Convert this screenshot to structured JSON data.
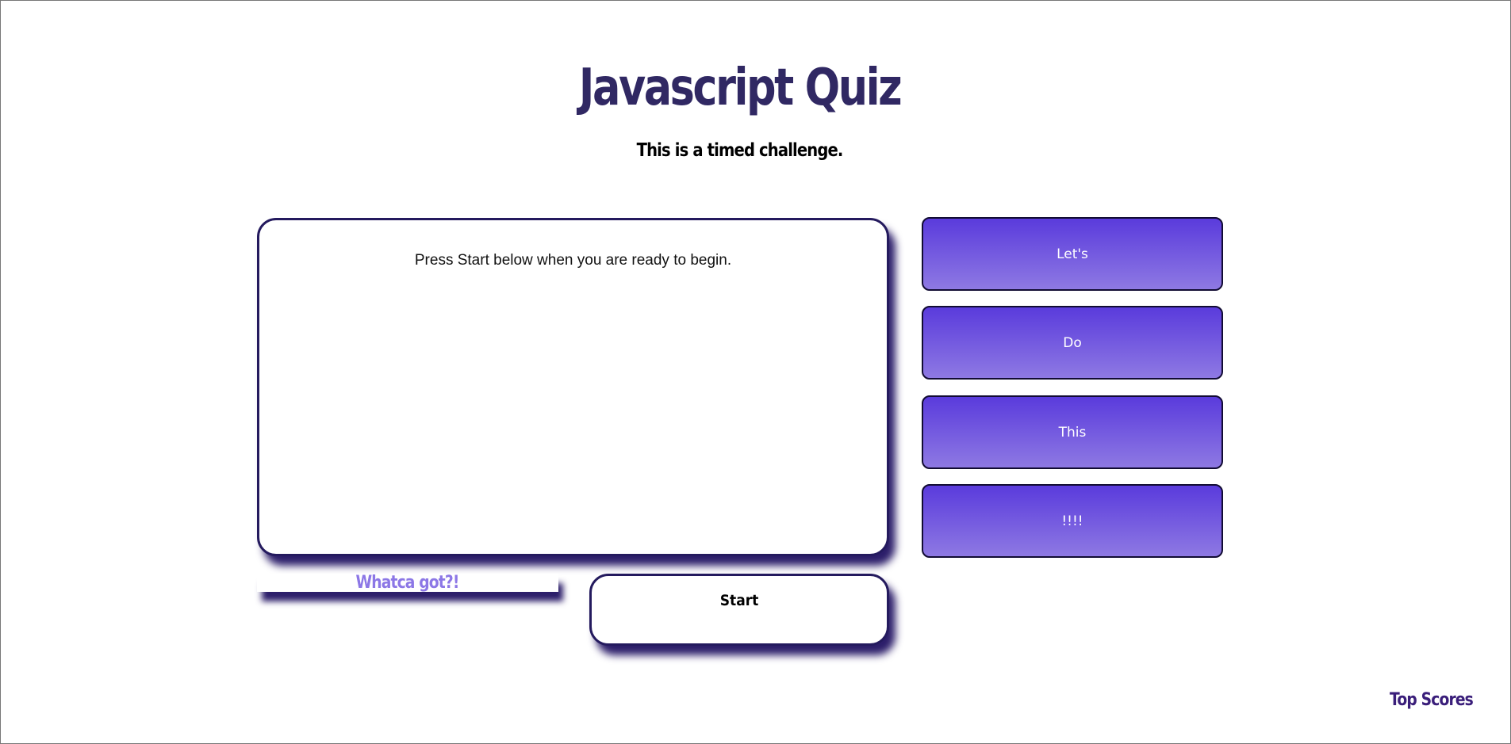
{
  "header": {
    "title": "Javascript Quiz",
    "subtitle": "This is a timed challenge."
  },
  "question": {
    "text": "Press Start below when you are ready to begin."
  },
  "answers": [
    {
      "label": "Let's"
    },
    {
      "label": "Do"
    },
    {
      "label": "This"
    },
    {
      "label": "!!!!"
    }
  ],
  "feedback": {
    "text": "Whatca got?!"
  },
  "controls": {
    "start_label": "Start"
  },
  "footer": {
    "top_scores_label": "Top Scores"
  },
  "colors": {
    "title": "#302863",
    "accent": "#5a3bdc",
    "accent_light": "#8e79e3",
    "shadow": "#2c1e6a",
    "feedback": "#8c77e6",
    "link": "#3a1e7a"
  }
}
